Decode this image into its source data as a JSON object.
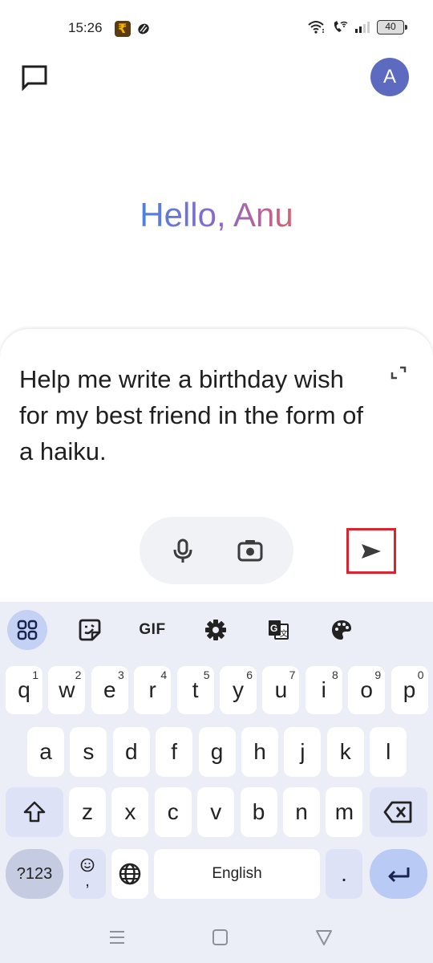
{
  "status_bar": {
    "time": "15:26",
    "battery": "40",
    "notification_icons": [
      "rupee-app-icon",
      "app-notification-icon"
    ],
    "system_icons": [
      "wifi-icon",
      "wifi-calling-icon",
      "signal-icon",
      "battery-icon"
    ]
  },
  "header": {
    "avatar_letter": "A",
    "avatar_color": "#5c6bc0"
  },
  "greeting": {
    "text": "Hello, Anu",
    "gradient": [
      "#4a82e4",
      "#8a6ac7",
      "#d36176"
    ]
  },
  "prompt": {
    "value": "Help me write a birthday wish for my best friend in the form of a haiku."
  },
  "highlight_color": "#d9232e",
  "keyboard": {
    "toolbar": [
      {
        "name": "apps-grid",
        "label": ""
      },
      {
        "name": "sticker",
        "label": ""
      },
      {
        "name": "gif",
        "label": "GIF"
      },
      {
        "name": "settings",
        "label": ""
      },
      {
        "name": "translate",
        "label": ""
      },
      {
        "name": "theme",
        "label": ""
      }
    ],
    "row1": [
      {
        "key": "q",
        "hint": "1"
      },
      {
        "key": "w",
        "hint": "2"
      },
      {
        "key": "e",
        "hint": "3"
      },
      {
        "key": "r",
        "hint": "4"
      },
      {
        "key": "t",
        "hint": "5"
      },
      {
        "key": "y",
        "hint": "6"
      },
      {
        "key": "u",
        "hint": "7"
      },
      {
        "key": "i",
        "hint": "8"
      },
      {
        "key": "o",
        "hint": "9"
      },
      {
        "key": "p",
        "hint": "0"
      }
    ],
    "row2": [
      "a",
      "s",
      "d",
      "f",
      "g",
      "h",
      "j",
      "k",
      "l"
    ],
    "row3": [
      "z",
      "x",
      "c",
      "v",
      "b",
      "n",
      "m"
    ],
    "row4": {
      "symbols": "?123",
      "comma": ",",
      "space": "English",
      "period": "."
    }
  }
}
